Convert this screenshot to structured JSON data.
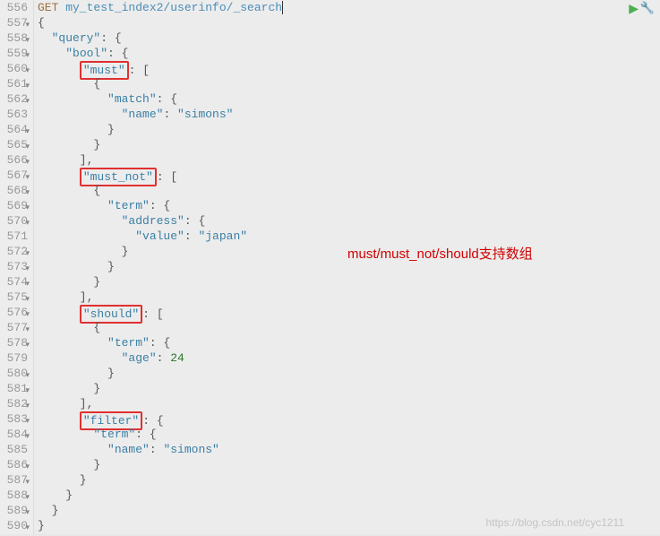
{
  "request": {
    "method": "GET",
    "path": "my_test_index2/userinfo/_search"
  },
  "gutter": {
    "start": 556,
    "end": 590
  },
  "code_tokens": {
    "line556_method": "GET",
    "line556_path": " my_test_index2/userinfo/_search",
    "l557": "{",
    "l558a": "  ",
    "l558_key": "\"query\"",
    "l558b": ": {",
    "l559a": "    ",
    "l559_key": "\"bool\"",
    "l559b": ": {",
    "l560a": "      ",
    "l560_key": "\"must\"",
    "l560b": ": [",
    "l561": "        {",
    "l562a": "          ",
    "l562_key": "\"match\"",
    "l562b": ": {",
    "l563a": "            ",
    "l563_key": "\"name\"",
    "l563b": ": ",
    "l563_val": "\"simons\"",
    "l564": "          }",
    "l565": "        }",
    "l566": "      ],",
    "l567a": "      ",
    "l567_key": "\"must_not\"",
    "l567b": ": [",
    "l568": "        {",
    "l569a": "          ",
    "l569_key": "\"term\"",
    "l569b": ": {",
    "l570a": "            ",
    "l570_key": "\"address\"",
    "l570b": ": {",
    "l571a": "              ",
    "l571_key": "\"value\"",
    "l571b": ": ",
    "l571_val": "\"japan\"",
    "l572": "            }",
    "l573": "          }",
    "l574": "        }",
    "l575": "      ],",
    "l576a": "      ",
    "l576_key": "\"should\"",
    "l576b": ": [",
    "l577": "        {",
    "l578a": "          ",
    "l578_key": "\"term\"",
    "l578b": ": {",
    "l579a": "            ",
    "l579_key": "\"age\"",
    "l579b": ": ",
    "l579_val": "24",
    "l580": "          }",
    "l581": "        }",
    "l582": "      ],",
    "l583a": "      ",
    "l583_key": "\"filter\"",
    "l583b": ": {",
    "l584a": "        ",
    "l584_key": "\"term\"",
    "l584b": ": {",
    "l585a": "          ",
    "l585_key": "\"name\"",
    "l585b": ": ",
    "l585_val": "\"simons\"",
    "l586": "        }",
    "l587": "      }",
    "l588": "    }",
    "l589": "  }",
    "l590": "}"
  },
  "annotation": {
    "text": "must/must_not/should支持数组"
  },
  "watermark": "https://blog.csdn.net/cyc1211"
}
